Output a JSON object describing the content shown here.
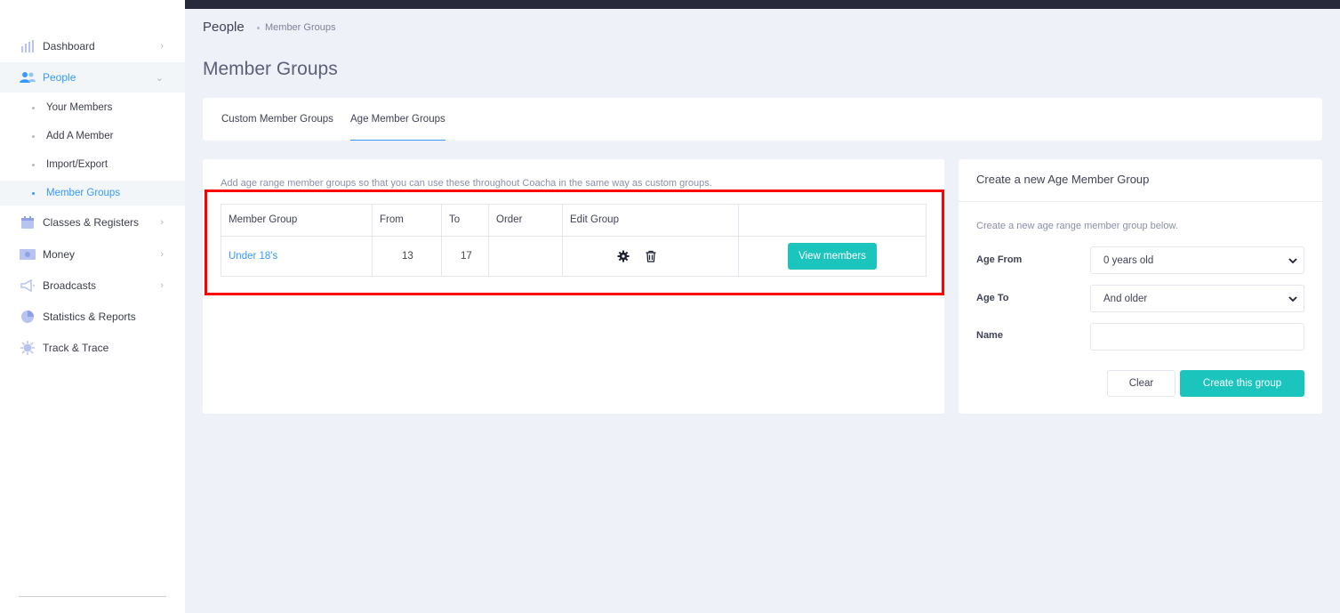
{
  "sidebar": {
    "items": [
      {
        "label": "Dashboard",
        "icon": "bar-chart-icon"
      },
      {
        "label": "People",
        "icon": "people-icon"
      },
      {
        "label": "Classes & Registers",
        "icon": "calendar-icon"
      },
      {
        "label": "Money",
        "icon": "money-icon"
      },
      {
        "label": "Broadcasts",
        "icon": "megaphone-icon"
      },
      {
        "label": "Statistics & Reports",
        "icon": "pie-chart-icon"
      },
      {
        "label": "Track & Trace",
        "icon": "virus-icon"
      }
    ],
    "people_sub": [
      {
        "label": "Your Members"
      },
      {
        "label": "Add A Member"
      },
      {
        "label": "Import/Export"
      },
      {
        "label": "Member Groups"
      }
    ]
  },
  "breadcrumb": {
    "title": "People",
    "current": "Member Groups"
  },
  "page": {
    "title": "Member Groups"
  },
  "tabs": [
    {
      "label": "Custom Member Groups"
    },
    {
      "label": "Age Member Groups"
    }
  ],
  "main": {
    "description": "Add age range member groups so that you can use these throughout Coacha in the same way as custom groups.",
    "columns": [
      "Member Group",
      "From",
      "To",
      "Order",
      "Edit Group"
    ],
    "rows": [
      {
        "group": "Under 18's",
        "from": "13",
        "to": "17",
        "order": "",
        "view_label": "View members"
      }
    ]
  },
  "form": {
    "title": "Create a new Age Member Group",
    "description": "Create a new age range member group below.",
    "age_from_label": "Age From",
    "age_from_value": "0 years old",
    "age_to_label": "Age To",
    "age_to_value": "And older",
    "name_label": "Name",
    "name_value": "",
    "clear_label": "Clear",
    "create_label": "Create this group"
  },
  "colors": {
    "accent": "#3699ff",
    "teal": "#1bc5bd",
    "highlight": "#ff0000",
    "topbar": "#262a3b"
  }
}
